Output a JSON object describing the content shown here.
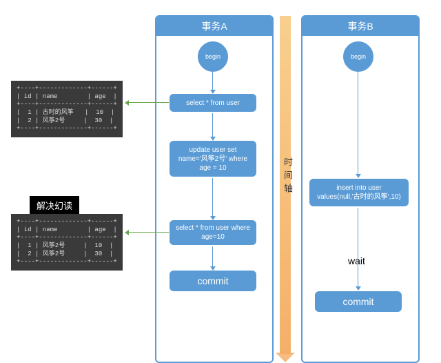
{
  "txA": {
    "header": "事务A",
    "begin": "begin",
    "step1": "select * from user",
    "step2": "update user set name='风筝2号' where age = 10",
    "step3": "select * from user where age=10",
    "commit": "commit"
  },
  "txB": {
    "header": "事务B",
    "begin": "begin",
    "insert": "insert into user values(null,'古时的风筝',10)",
    "wait": "wait",
    "commit": "commit"
  },
  "tableTop": "+----+-------------+------+\n| id | name        | age  |\n+----+-------------+------+\n|  1 | 古时的风筝   |  10  |\n|  2 | 风筝2号     |  30  |\n+----+-------------+------+",
  "tableBottomLabel": "解决幻读",
  "tableBottom": "+----+-------------+------+\n| id | name        | age  |\n+----+-------------+------+\n|  1 | 风筝2号     |  10  |\n|  2 | 风筝2号     |  30  |\n+----+-------------+------+",
  "timeAxis": "时间轴"
}
